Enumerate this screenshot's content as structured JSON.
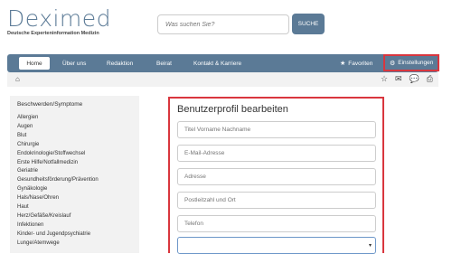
{
  "header": {
    "logo_text": "Deximed",
    "logo_sub": "Deutsche Experteninformation Medizin",
    "search_placeholder": "Was suchen Sie?",
    "search_button": "SUCHE"
  },
  "nav": {
    "items": [
      "Home",
      "Über uns",
      "Redaktion",
      "Beirat",
      "Kontakt & Karriere"
    ],
    "favoriten": "Favoriten",
    "einstellungen": "Einstellungen"
  },
  "sidebar": {
    "heading": "Beschwerden/Symptome",
    "items": [
      "Allergien",
      "Augen",
      "Blut",
      "Chirurgie",
      "Endokrinologie/Stoffwechsel",
      "Erste Hilfe/Notfallmedizin",
      "Geriatrie",
      "Gesundheitsförderung/Prävention",
      "Gynäkologie",
      "Hals/Nase/Ohren",
      "Haut",
      "Herz/Gefäße/Kreislauf",
      "Infektionen",
      "Kinder- und Jugendpsychiatrie",
      "Lunge/Atemwege"
    ]
  },
  "form": {
    "title": "Benutzerprofil bearbeiten",
    "fields": [
      "Titel Vorname Nachname",
      "E-Mail-Adresse",
      "Adresse",
      "Postleitzahl und Ort",
      "Telefon"
    ]
  }
}
